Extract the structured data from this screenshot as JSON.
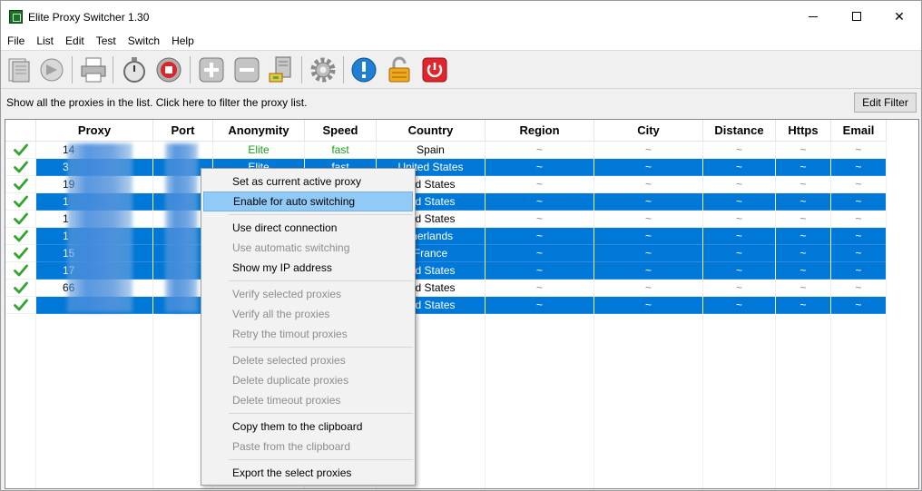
{
  "window": {
    "title": "Elite Proxy Switcher 1.30",
    "minimize_glyph": "",
    "close_glyph": "✕"
  },
  "menu": [
    "File",
    "List",
    "Edit",
    "Test",
    "Switch",
    "Help"
  ],
  "toolbar": {
    "icons": [
      "new-list-icon",
      "open-list-icon",
      "print-icon",
      "test-stopwatch-icon",
      "stop-test-icon",
      "add-proxy-icon",
      "remove-proxy-icon",
      "server-icon",
      "settings-gear-icon",
      "info-icon",
      "lock-icon",
      "power-icon"
    ]
  },
  "filter": {
    "text": "Show all the proxies in the list. Click here to filter the proxy list.",
    "edit_filter_label": "Edit Filter"
  },
  "columns": [
    "Proxy",
    "Port",
    "Anonymity",
    "Speed",
    "Country",
    "Region",
    "City",
    "Distance",
    "Https",
    "Email"
  ],
  "rows": [
    {
      "proxy": "14",
      "anonymity": "Elite",
      "speed": "fast",
      "country": "Spain",
      "region": "~",
      "city": "~",
      "distance": "~",
      "https": "~",
      "email": "~",
      "selected": false
    },
    {
      "proxy": "3",
      "anonymity": "Elite",
      "speed": "fast",
      "country": "United States",
      "region": "~",
      "city": "~",
      "distance": "~",
      "https": "~",
      "email": "~",
      "selected": true
    },
    {
      "proxy": "19",
      "anonymity": "",
      "speed": "",
      "country": "ted States",
      "region": "~",
      "city": "~",
      "distance": "~",
      "https": "~",
      "email": "~",
      "selected": false
    },
    {
      "proxy": "1",
      "anonymity": "",
      "speed": "",
      "country": "ted States",
      "region": "~",
      "city": "~",
      "distance": "~",
      "https": "~",
      "email": "~",
      "selected": true
    },
    {
      "proxy": "1",
      "anonymity": "",
      "speed": "",
      "country": "ted States",
      "region": "~",
      "city": "~",
      "distance": "~",
      "https": "~",
      "email": "~",
      "selected": false
    },
    {
      "proxy": "1",
      "anonymity": "",
      "speed": "",
      "country": "therlands",
      "region": "~",
      "city": "~",
      "distance": "~",
      "https": "~",
      "email": "~",
      "selected": true
    },
    {
      "proxy": "15",
      "anonymity": "",
      "speed": "",
      "country": "France",
      "region": "~",
      "city": "~",
      "distance": "~",
      "https": "~",
      "email": "~",
      "selected": true
    },
    {
      "proxy": "17",
      "anonymity": "",
      "speed": "",
      "country": "ted States",
      "region": "~",
      "city": "~",
      "distance": "~",
      "https": "~",
      "email": "~",
      "selected": true
    },
    {
      "proxy": "66",
      "anonymity": "",
      "speed": "",
      "country": "ted States",
      "region": "~",
      "city": "~",
      "distance": "~",
      "https": "~",
      "email": "~",
      "selected": false
    },
    {
      "proxy": "",
      "anonymity": "",
      "speed": "",
      "country": "ted States",
      "region": "~",
      "city": "~",
      "distance": "~",
      "https": "~",
      "email": "~",
      "selected": true
    }
  ],
  "context_menu": {
    "items": [
      {
        "label": "Set as current active proxy",
        "disabled": false,
        "hover": false
      },
      {
        "label": "Enable for auto switching",
        "disabled": false,
        "hover": true
      },
      {
        "sep": true
      },
      {
        "label": "Use direct connection",
        "disabled": false,
        "hover": false
      },
      {
        "label": "Use automatic switching",
        "disabled": true,
        "hover": false
      },
      {
        "label": "Show my IP address",
        "disabled": false,
        "hover": false
      },
      {
        "sep": true
      },
      {
        "label": "Verify selected proxies",
        "disabled": true,
        "hover": false
      },
      {
        "label": "Verify all the proxies",
        "disabled": true,
        "hover": false
      },
      {
        "label": "Retry the timout proxies",
        "disabled": true,
        "hover": false
      },
      {
        "sep": true
      },
      {
        "label": "Delete selected proxies",
        "disabled": true,
        "hover": false
      },
      {
        "label": "Delete duplicate proxies",
        "disabled": true,
        "hover": false
      },
      {
        "label": "Delete timeout proxies",
        "disabled": true,
        "hover": false
      },
      {
        "sep": true
      },
      {
        "label": "Copy them to the clipboard",
        "disabled": false,
        "hover": false
      },
      {
        "label": "Paste from the clipboard",
        "disabled": true,
        "hover": false
      },
      {
        "sep": true
      },
      {
        "label": "Export the select proxies",
        "disabled": false,
        "hover": false
      }
    ]
  },
  "colors": {
    "selection": "#0078d7",
    "menu_hover": "#91c9f7",
    "good_status": "#19a019"
  }
}
